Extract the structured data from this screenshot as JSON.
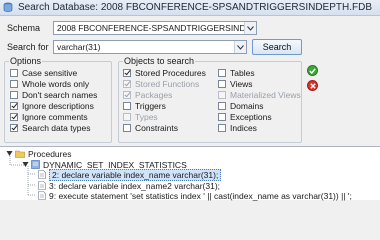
{
  "window": {
    "title": "Search Database: 2008 FBCONFERENCE-SPSANDTRIGGERSINDEPTH.FDB"
  },
  "schema": {
    "label": "Schema",
    "value": "2008 FBCONFERENCE-SPSANDTRIGGERSINDEPTH.FDB"
  },
  "search": {
    "label": "Search for",
    "value": "varchar(31)",
    "button": "Search"
  },
  "options": {
    "title": "Options",
    "items": [
      {
        "label": "Case sensitive",
        "checked": false
      },
      {
        "label": "Whole words only",
        "checked": false
      },
      {
        "label": "Don't search names",
        "checked": false
      },
      {
        "label": "Ignore descriptions",
        "checked": true
      },
      {
        "label": "Ignore comments",
        "checked": true
      },
      {
        "label": "Search data types",
        "checked": true
      }
    ]
  },
  "objects": {
    "title": "Objects to search",
    "col1": [
      {
        "label": "Stored Procedures",
        "checked": true,
        "enabled": true
      },
      {
        "label": "Stored Functions",
        "checked": true,
        "enabled": false
      },
      {
        "label": "Packages",
        "checked": true,
        "enabled": false
      },
      {
        "label": "Triggers",
        "checked": false,
        "enabled": true
      },
      {
        "label": "Types",
        "checked": false,
        "enabled": false
      },
      {
        "label": "Constraints",
        "checked": false,
        "enabled": true
      }
    ],
    "col2": [
      {
        "label": "Tables",
        "checked": false,
        "enabled": true
      },
      {
        "label": "Views",
        "checked": false,
        "enabled": true
      },
      {
        "label": "Materialized Views",
        "checked": false,
        "enabled": false
      },
      {
        "label": "Domains",
        "checked": false,
        "enabled": true
      },
      {
        "label": "Exceptions",
        "checked": false,
        "enabled": true
      },
      {
        "label": "Indices",
        "checked": false,
        "enabled": true
      }
    ]
  },
  "icons": {
    "select_all": "check-all-icon",
    "deselect_all": "clear-all-icon",
    "accent_green": "#3aa935",
    "accent_red": "#d8322c"
  },
  "results": {
    "root": "Procedures",
    "child": "DYNAMIC_SET_INDEX_STATISTICS",
    "lines": [
      "2: declare variable index_name varchar(31);",
      "3: declare variable index_name2 varchar(31);",
      "9: execute statement 'set statistics index ' || cast(index_name as varchar(31)) || ';"
    ]
  }
}
